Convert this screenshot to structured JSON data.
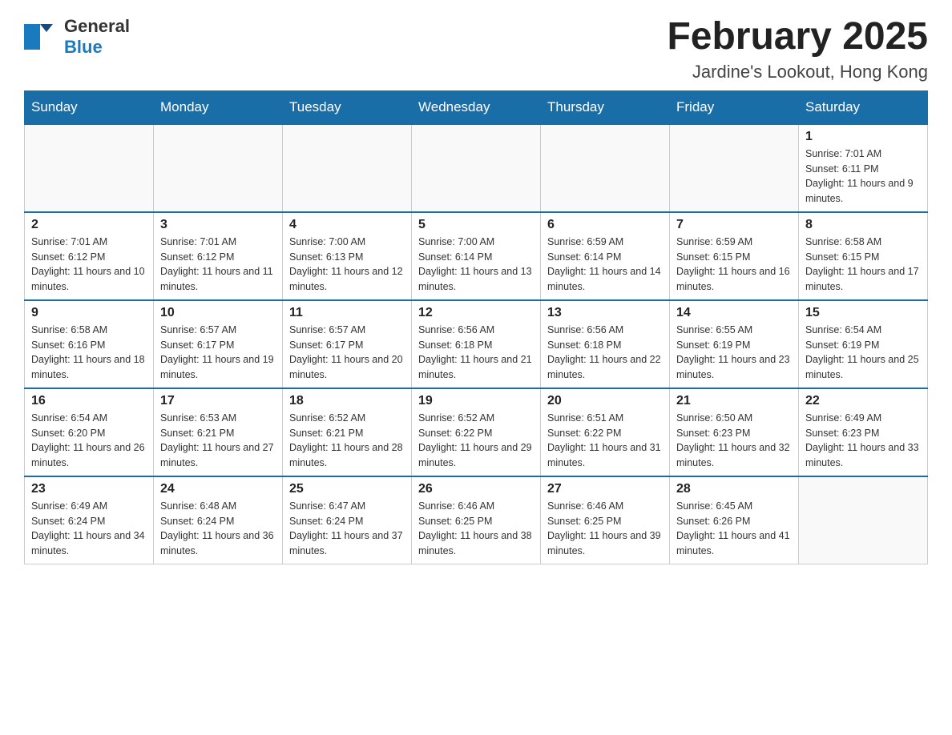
{
  "logo": {
    "text_general": "General",
    "text_blue": "Blue"
  },
  "header": {
    "month_title": "February 2025",
    "location": "Jardine's Lookout, Hong Kong"
  },
  "weekdays": [
    "Sunday",
    "Monday",
    "Tuesday",
    "Wednesday",
    "Thursday",
    "Friday",
    "Saturday"
  ],
  "weeks": [
    [
      {
        "day": "",
        "info": ""
      },
      {
        "day": "",
        "info": ""
      },
      {
        "day": "",
        "info": ""
      },
      {
        "day": "",
        "info": ""
      },
      {
        "day": "",
        "info": ""
      },
      {
        "day": "",
        "info": ""
      },
      {
        "day": "1",
        "info": "Sunrise: 7:01 AM\nSunset: 6:11 PM\nDaylight: 11 hours and 9 minutes."
      }
    ],
    [
      {
        "day": "2",
        "info": "Sunrise: 7:01 AM\nSunset: 6:12 PM\nDaylight: 11 hours and 10 minutes."
      },
      {
        "day": "3",
        "info": "Sunrise: 7:01 AM\nSunset: 6:12 PM\nDaylight: 11 hours and 11 minutes."
      },
      {
        "day": "4",
        "info": "Sunrise: 7:00 AM\nSunset: 6:13 PM\nDaylight: 11 hours and 12 minutes."
      },
      {
        "day": "5",
        "info": "Sunrise: 7:00 AM\nSunset: 6:14 PM\nDaylight: 11 hours and 13 minutes."
      },
      {
        "day": "6",
        "info": "Sunrise: 6:59 AM\nSunset: 6:14 PM\nDaylight: 11 hours and 14 minutes."
      },
      {
        "day": "7",
        "info": "Sunrise: 6:59 AM\nSunset: 6:15 PM\nDaylight: 11 hours and 16 minutes."
      },
      {
        "day": "8",
        "info": "Sunrise: 6:58 AM\nSunset: 6:15 PM\nDaylight: 11 hours and 17 minutes."
      }
    ],
    [
      {
        "day": "9",
        "info": "Sunrise: 6:58 AM\nSunset: 6:16 PM\nDaylight: 11 hours and 18 minutes."
      },
      {
        "day": "10",
        "info": "Sunrise: 6:57 AM\nSunset: 6:17 PM\nDaylight: 11 hours and 19 minutes."
      },
      {
        "day": "11",
        "info": "Sunrise: 6:57 AM\nSunset: 6:17 PM\nDaylight: 11 hours and 20 minutes."
      },
      {
        "day": "12",
        "info": "Sunrise: 6:56 AM\nSunset: 6:18 PM\nDaylight: 11 hours and 21 minutes."
      },
      {
        "day": "13",
        "info": "Sunrise: 6:56 AM\nSunset: 6:18 PM\nDaylight: 11 hours and 22 minutes."
      },
      {
        "day": "14",
        "info": "Sunrise: 6:55 AM\nSunset: 6:19 PM\nDaylight: 11 hours and 23 minutes."
      },
      {
        "day": "15",
        "info": "Sunrise: 6:54 AM\nSunset: 6:19 PM\nDaylight: 11 hours and 25 minutes."
      }
    ],
    [
      {
        "day": "16",
        "info": "Sunrise: 6:54 AM\nSunset: 6:20 PM\nDaylight: 11 hours and 26 minutes."
      },
      {
        "day": "17",
        "info": "Sunrise: 6:53 AM\nSunset: 6:21 PM\nDaylight: 11 hours and 27 minutes."
      },
      {
        "day": "18",
        "info": "Sunrise: 6:52 AM\nSunset: 6:21 PM\nDaylight: 11 hours and 28 minutes."
      },
      {
        "day": "19",
        "info": "Sunrise: 6:52 AM\nSunset: 6:22 PM\nDaylight: 11 hours and 29 minutes."
      },
      {
        "day": "20",
        "info": "Sunrise: 6:51 AM\nSunset: 6:22 PM\nDaylight: 11 hours and 31 minutes."
      },
      {
        "day": "21",
        "info": "Sunrise: 6:50 AM\nSunset: 6:23 PM\nDaylight: 11 hours and 32 minutes."
      },
      {
        "day": "22",
        "info": "Sunrise: 6:49 AM\nSunset: 6:23 PM\nDaylight: 11 hours and 33 minutes."
      }
    ],
    [
      {
        "day": "23",
        "info": "Sunrise: 6:49 AM\nSunset: 6:24 PM\nDaylight: 11 hours and 34 minutes."
      },
      {
        "day": "24",
        "info": "Sunrise: 6:48 AM\nSunset: 6:24 PM\nDaylight: 11 hours and 36 minutes."
      },
      {
        "day": "25",
        "info": "Sunrise: 6:47 AM\nSunset: 6:24 PM\nDaylight: 11 hours and 37 minutes."
      },
      {
        "day": "26",
        "info": "Sunrise: 6:46 AM\nSunset: 6:25 PM\nDaylight: 11 hours and 38 minutes."
      },
      {
        "day": "27",
        "info": "Sunrise: 6:46 AM\nSunset: 6:25 PM\nDaylight: 11 hours and 39 minutes."
      },
      {
        "day": "28",
        "info": "Sunrise: 6:45 AM\nSunset: 6:26 PM\nDaylight: 11 hours and 41 minutes."
      },
      {
        "day": "",
        "info": ""
      }
    ]
  ]
}
